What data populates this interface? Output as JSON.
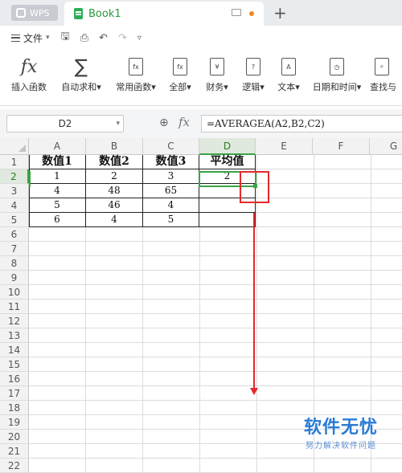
{
  "titlebar": {
    "app_tab": "WPS",
    "doc_tab": "Book1",
    "new_tab": "+"
  },
  "menubar": {
    "file_menu": "文件"
  },
  "ribbon": {
    "items": [
      {
        "label": "插入函数",
        "icon": "fx-icon"
      },
      {
        "label": "自动求和",
        "icon": "sigma-icon"
      },
      {
        "label": "常用函数",
        "icon": "fx-star-icon"
      },
      {
        "label": "全部",
        "icon": "fx-list-icon"
      },
      {
        "label": "财务",
        "icon": "yen-icon"
      },
      {
        "label": "逻辑",
        "icon": "question-icon"
      },
      {
        "label": "文本",
        "icon": "text-a-icon"
      },
      {
        "label": "日期和时间",
        "icon": "clock-icon"
      },
      {
        "label": "查找与",
        "icon": "lookup-icon"
      }
    ]
  },
  "formula_bar": {
    "name_box": "D2",
    "formula": "=AVERAGEA(A2,B2,C2)"
  },
  "sheet": {
    "columns": [
      "A",
      "B",
      "C",
      "D",
      "E",
      "F",
      "G"
    ],
    "rows": [
      "1",
      "2",
      "3",
      "4",
      "5",
      "6",
      "7",
      "8",
      "9",
      "10",
      "11",
      "12",
      "13",
      "14",
      "15",
      "16",
      "17",
      "18",
      "19",
      "20",
      "21",
      "22"
    ],
    "headers": [
      "数值1",
      "数值2",
      "数值3",
      "平均值"
    ],
    "data": [
      [
        "1",
        "2",
        "3",
        "2"
      ],
      [
        "4",
        "48",
        "65",
        ""
      ],
      [
        "5",
        "46",
        "4",
        ""
      ],
      [
        "6",
        "4",
        "5",
        ""
      ]
    ]
  },
  "watermark": {
    "title": "软件无忧",
    "subtitle": "努力解决软件问题"
  }
}
